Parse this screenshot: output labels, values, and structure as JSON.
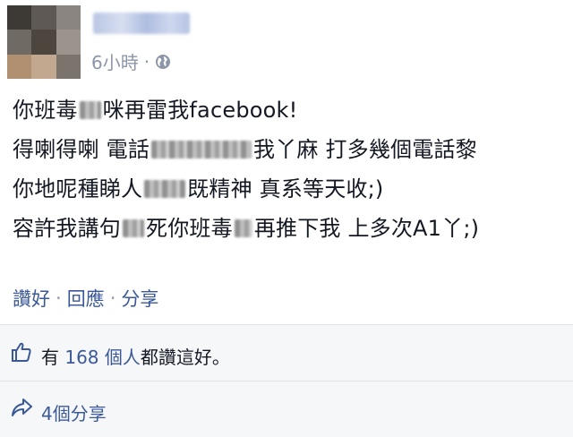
{
  "post": {
    "timestamp": "6小時",
    "meta_separator": "·",
    "lines": [
      [
        "你班毒",
        "咪再雷我facebook!"
      ],
      [
        "得喇得喇 電話",
        "我丫麻 打多幾個電話黎"
      ],
      [
        "你地呢種睇人",
        "既精神 真系等天收;)"
      ],
      [
        "容許我講句",
        "死你班毒",
        "再推下我 上多次A1丫;)"
      ]
    ]
  },
  "actions": {
    "like": "讚好",
    "comment": "回應",
    "share": "分享",
    "separator": "·"
  },
  "likes": {
    "prefix": "有",
    "count_text": "168 個人",
    "suffix": "都讚這好。"
  },
  "shares": {
    "label": "4個分享"
  },
  "colors": {
    "link": "#3b5998",
    "muted": "#8c96a8",
    "footer_bg": "#f6f7f9"
  },
  "icons": {
    "globe": "globe-icon",
    "thumb": "thumbs-up-icon",
    "share": "share-arrow-icon"
  }
}
